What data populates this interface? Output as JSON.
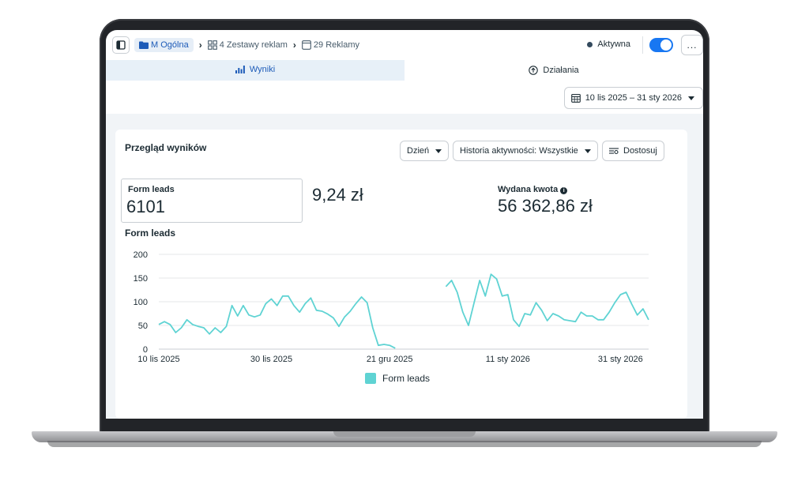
{
  "topbar": {
    "breadcrumb": [
      {
        "label": "M Ogólna",
        "icon": "folder-icon"
      },
      {
        "label": "4 Zestawy reklam",
        "icon": "grid-icon"
      },
      {
        "label": "29 Reklamy",
        "icon": "ad-icon"
      }
    ],
    "status_label": "Aktywna",
    "toggle_on": true,
    "more_label": "..."
  },
  "tabs": [
    {
      "label": "Wyniki",
      "icon": "bar-chart-icon",
      "active": true
    },
    {
      "label": "Działania",
      "icon": "upload-circle-icon",
      "active": false
    }
  ],
  "date_range": {
    "label": "10 lis 2025 – 31 sty 2026",
    "icon": "calendar-icon"
  },
  "overview": {
    "title": "Przegląd wyników",
    "controls": {
      "granularity": "Dzień",
      "history": "Historia aktywności: Wszystkie",
      "customize": "Dostosuj"
    }
  },
  "metrics": {
    "form_leads_label": "Form leads",
    "form_leads_value": "6101",
    "cost_per_lead": "9,24 zł",
    "spent_label": "Wydana kwota",
    "spent_value": "56 362,86 zł"
  },
  "colors": {
    "accent": "#1877f2",
    "series": "#5fd3d3",
    "active_tab_bg": "#e7f0f8"
  },
  "chart_data": {
    "type": "line",
    "title": "Form leads",
    "ylim": [
      0,
      200
    ],
    "yticks": [
      "0",
      "50",
      "100",
      "150",
      "200"
    ],
    "xticks": [
      {
        "label": "10 lis 2025",
        "index": 0
      },
      {
        "label": "30 lis 2025",
        "index": 20
      },
      {
        "label": "21 gru 2025",
        "index": 41
      },
      {
        "label": "11 sty 2026",
        "index": 62
      },
      {
        "label": "31 sty 2026",
        "index": 82
      }
    ],
    "x_start": "2025-11-10",
    "x_end": "2026-01-31",
    "grid": true,
    "legend": "bottom",
    "series": [
      {
        "name": "Form leads",
        "values": [
          52,
          58,
          52,
          35,
          45,
          62,
          52,
          48,
          45,
          32,
          45,
          35,
          48,
          92,
          70,
          92,
          72,
          68,
          72,
          96,
          106,
          92,
          112,
          112,
          92,
          78,
          96,
          108,
          82,
          80,
          74,
          66,
          48,
          68,
          80,
          96,
          110,
          98,
          45,
          8,
          10,
          8,
          2,
          null,
          null,
          null,
          null,
          null,
          null,
          null,
          null,
          132,
          145,
          120,
          78,
          50,
          98,
          145,
          112,
          158,
          148,
          112,
          115,
          62,
          48,
          75,
          72,
          98,
          82,
          60,
          75,
          70,
          62,
          60,
          58,
          78,
          70,
          70,
          62,
          62,
          78,
          98,
          115,
          120,
          95,
          72,
          85,
          62
        ]
      }
    ]
  },
  "legend_label": "Form leads"
}
